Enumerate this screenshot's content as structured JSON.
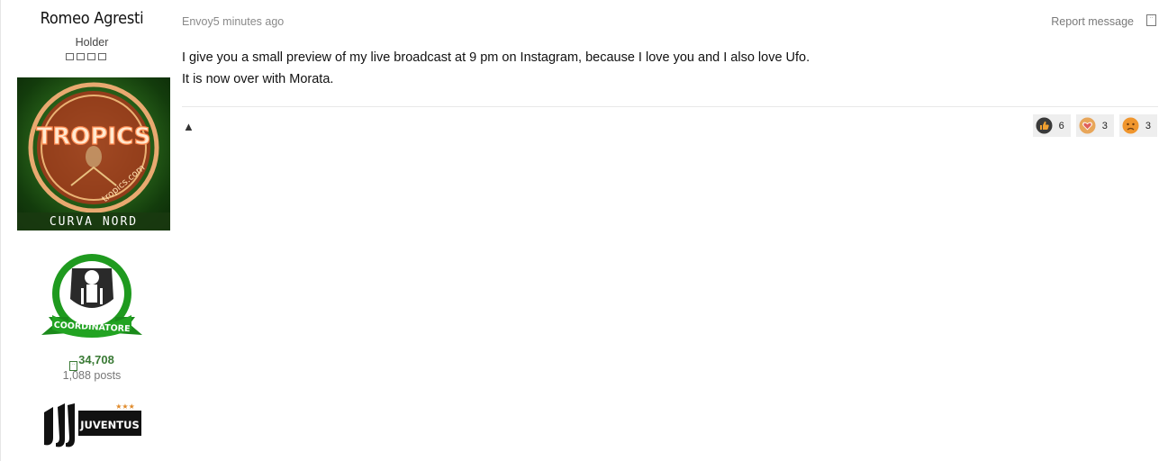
{
  "author": {
    "name": "Romeo Agresti",
    "rank": "Holder",
    "avatar_text_top": "TROPICS",
    "avatar_text_mid": "tropics.com",
    "avatar_text_bottom": "CURVA NORD",
    "badge_text": "COORDINATORE",
    "reputation": "34,708",
    "posts": "1,088 posts",
    "team_logo_text": "JUVENTUS"
  },
  "message": {
    "meta": "Envoy5 minutes ago",
    "report_label": "Report message",
    "lines": [
      "I give you a small preview of my live broadcast at 9 pm on Instagram, because I love you and I also love Ufo.",
      "It is now over with Morata."
    ],
    "up_arrow": "▲"
  },
  "reactions": [
    {
      "icon": "thumbs-up-icon",
      "count": "6",
      "color": "#3a3a3a"
    },
    {
      "icon": "heart-icon",
      "count": "3",
      "color": "#e8a65a"
    },
    {
      "icon": "sad-face-icon",
      "count": "3",
      "color": "#f0962e"
    }
  ],
  "colors": {
    "reputation": "#3a7a35",
    "badge_green": "#1f9a1f",
    "reaction_bg": "#eeeeee"
  }
}
